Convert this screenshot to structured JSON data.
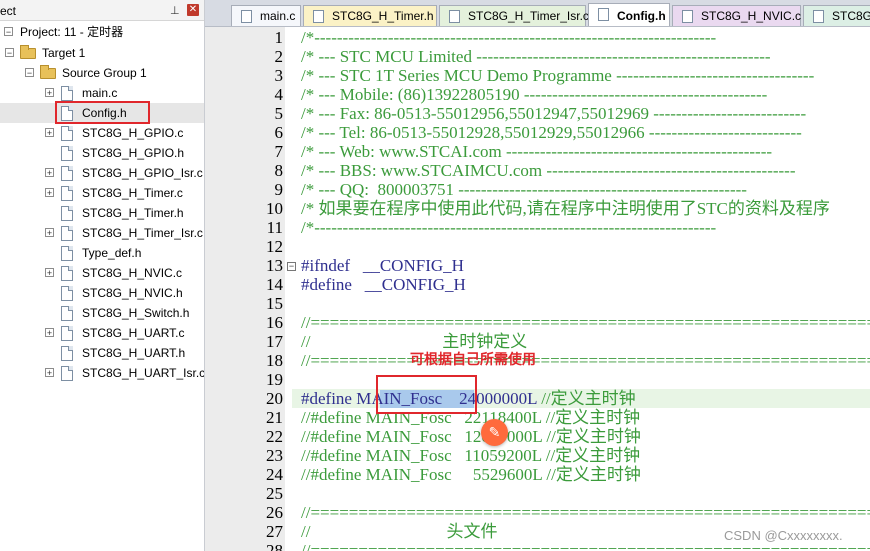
{
  "panel": {
    "title": "ect",
    "pin_icon": "pin-icon",
    "close_icon": "close-icon"
  },
  "tree": {
    "project": "Project: 11 - 定时器",
    "target": "Target 1",
    "group": "Source Group 1",
    "files": [
      {
        "name": "main.c",
        "expander": "+"
      },
      {
        "name": "Config.h",
        "expander": ""
      },
      {
        "name": "STC8G_H_GPIO.c",
        "expander": "+"
      },
      {
        "name": "STC8G_H_GPIO.h",
        "expander": ""
      },
      {
        "name": "STC8G_H_GPIO_Isr.c",
        "expander": "+"
      },
      {
        "name": "STC8G_H_Timer.c",
        "expander": "+"
      },
      {
        "name": "STC8G_H_Timer.h",
        "expander": ""
      },
      {
        "name": "STC8G_H_Timer_Isr.c",
        "expander": "+"
      },
      {
        "name": "Type_def.h",
        "expander": ""
      },
      {
        "name": "STC8G_H_NVIC.c",
        "expander": "+"
      },
      {
        "name": "STC8G_H_NVIC.h",
        "expander": ""
      },
      {
        "name": "STC8G_H_Switch.h",
        "expander": ""
      },
      {
        "name": "STC8G_H_UART.c",
        "expander": "+"
      },
      {
        "name": "STC8G_H_UART.h",
        "expander": ""
      },
      {
        "name": "STC8G_H_UART_Isr.c",
        "expander": "+"
      }
    ]
  },
  "tabs": [
    {
      "label": "main.c",
      "color": "#f5f7fb"
    },
    {
      "label": "STC8G_H_Timer.h",
      "color": "#fbf2c6"
    },
    {
      "label": "STC8G_H_Timer_Isr.c",
      "color": "#e4f1dc"
    },
    {
      "label": "Config.h",
      "color": "#ffffff",
      "active": true
    },
    {
      "label": "STC8G_H_NVIC.c",
      "color": "#ead9f0"
    },
    {
      "label": "STC8G_H",
      "color": "#dcefe5"
    }
  ],
  "code_lines": [
    {
      "n": "1",
      "text": "/*-----------------------------------------------------------------------",
      "kind": "comment"
    },
    {
      "n": "2",
      "text": "/* --- STC MCU Limited ----------------------------------------------------",
      "kind": "comment"
    },
    {
      "n": "3",
      "text": "/* --- STC 1T Series MCU Demo Programme -----------------------------------",
      "kind": "comment"
    },
    {
      "n": "4",
      "text": "/* --- Mobile: (86)13922805190 -------------------------------------------",
      "kind": "comment"
    },
    {
      "n": "5",
      "text": "/* --- Fax: 86-0513-55012956,55012947,55012969 ---------------------------",
      "kind": "comment"
    },
    {
      "n": "6",
      "text": "/* --- Tel: 86-0513-55012928,55012929,55012966 ---------------------------",
      "kind": "comment"
    },
    {
      "n": "7",
      "text": "/* --- Web: www.STCAI.com -----------------------------------------------",
      "kind": "comment"
    },
    {
      "n": "8",
      "text": "/* --- BBS: www.STCAIMCU.com --------------------------------------------",
      "kind": "comment"
    },
    {
      "n": "9",
      "text": "/* --- QQ:  800003751 ---------------------------------------------------",
      "kind": "comment"
    },
    {
      "n": "10",
      "text": "/* 如果要在程序中使用此代码,请在程序中注明使用了STC的资料及程序",
      "kind": "comment"
    },
    {
      "n": "11",
      "text": "/*-----------------------------------------------------------------------",
      "kind": "comment"
    },
    {
      "n": "12",
      "text": "",
      "kind": "comment"
    },
    {
      "n": "13",
      "text": "#ifndef   __CONFIG_H",
      "kind": "pre"
    },
    {
      "n": "14",
      "text": "#define   __CONFIG_H",
      "kind": "pre"
    },
    {
      "n": "15",
      "text": "",
      "kind": "comment"
    },
    {
      "n": "16",
      "text": "//========================================================================",
      "kind": "comment"
    },
    {
      "n": "17",
      "text": "//                               主时钟定义",
      "kind": "comment"
    },
    {
      "n": "18",
      "text": "//========================================================================",
      "kind": "comment"
    },
    {
      "n": "19",
      "text": "",
      "kind": "comment"
    },
    {
      "n": "20",
      "text": "#define MAIN_Fosc    24000000L //定义主时钟",
      "kind": "comment"
    },
    {
      "n": "21",
      "text": "//#define MAIN_Fosc   22118400L //定义主时钟",
      "kind": "comment"
    },
    {
      "n": "22",
      "text": "//#define MAIN_Fosc   12000000L //定义主时钟",
      "kind": "comment"
    },
    {
      "n": "23",
      "text": "//#define MAIN_Fosc   11059200L //定义主时钟",
      "kind": "comment"
    },
    {
      "n": "24",
      "text": "//#define MAIN_Fosc     5529600L //定义主时钟",
      "kind": "comment"
    },
    {
      "n": "25",
      "text": "",
      "kind": "comment"
    },
    {
      "n": "26",
      "text": "//========================================================================",
      "kind": "comment"
    },
    {
      "n": "27",
      "text": "//                                头文件",
      "kind": "comment"
    },
    {
      "n": "28",
      "text": "//========================================================================",
      "kind": "comment"
    }
  ],
  "annotation": {
    "text": "可根据自己所需使用",
    "edit_icon": "magic-edit-icon"
  },
  "watermark": "CSDN @Cxxxxxxxx.",
  "colors": {
    "comment": "#3b9b3b",
    "annotation": "#e0272c",
    "selection": "#a9c9ec",
    "current_line": "#e8f5e5"
  }
}
